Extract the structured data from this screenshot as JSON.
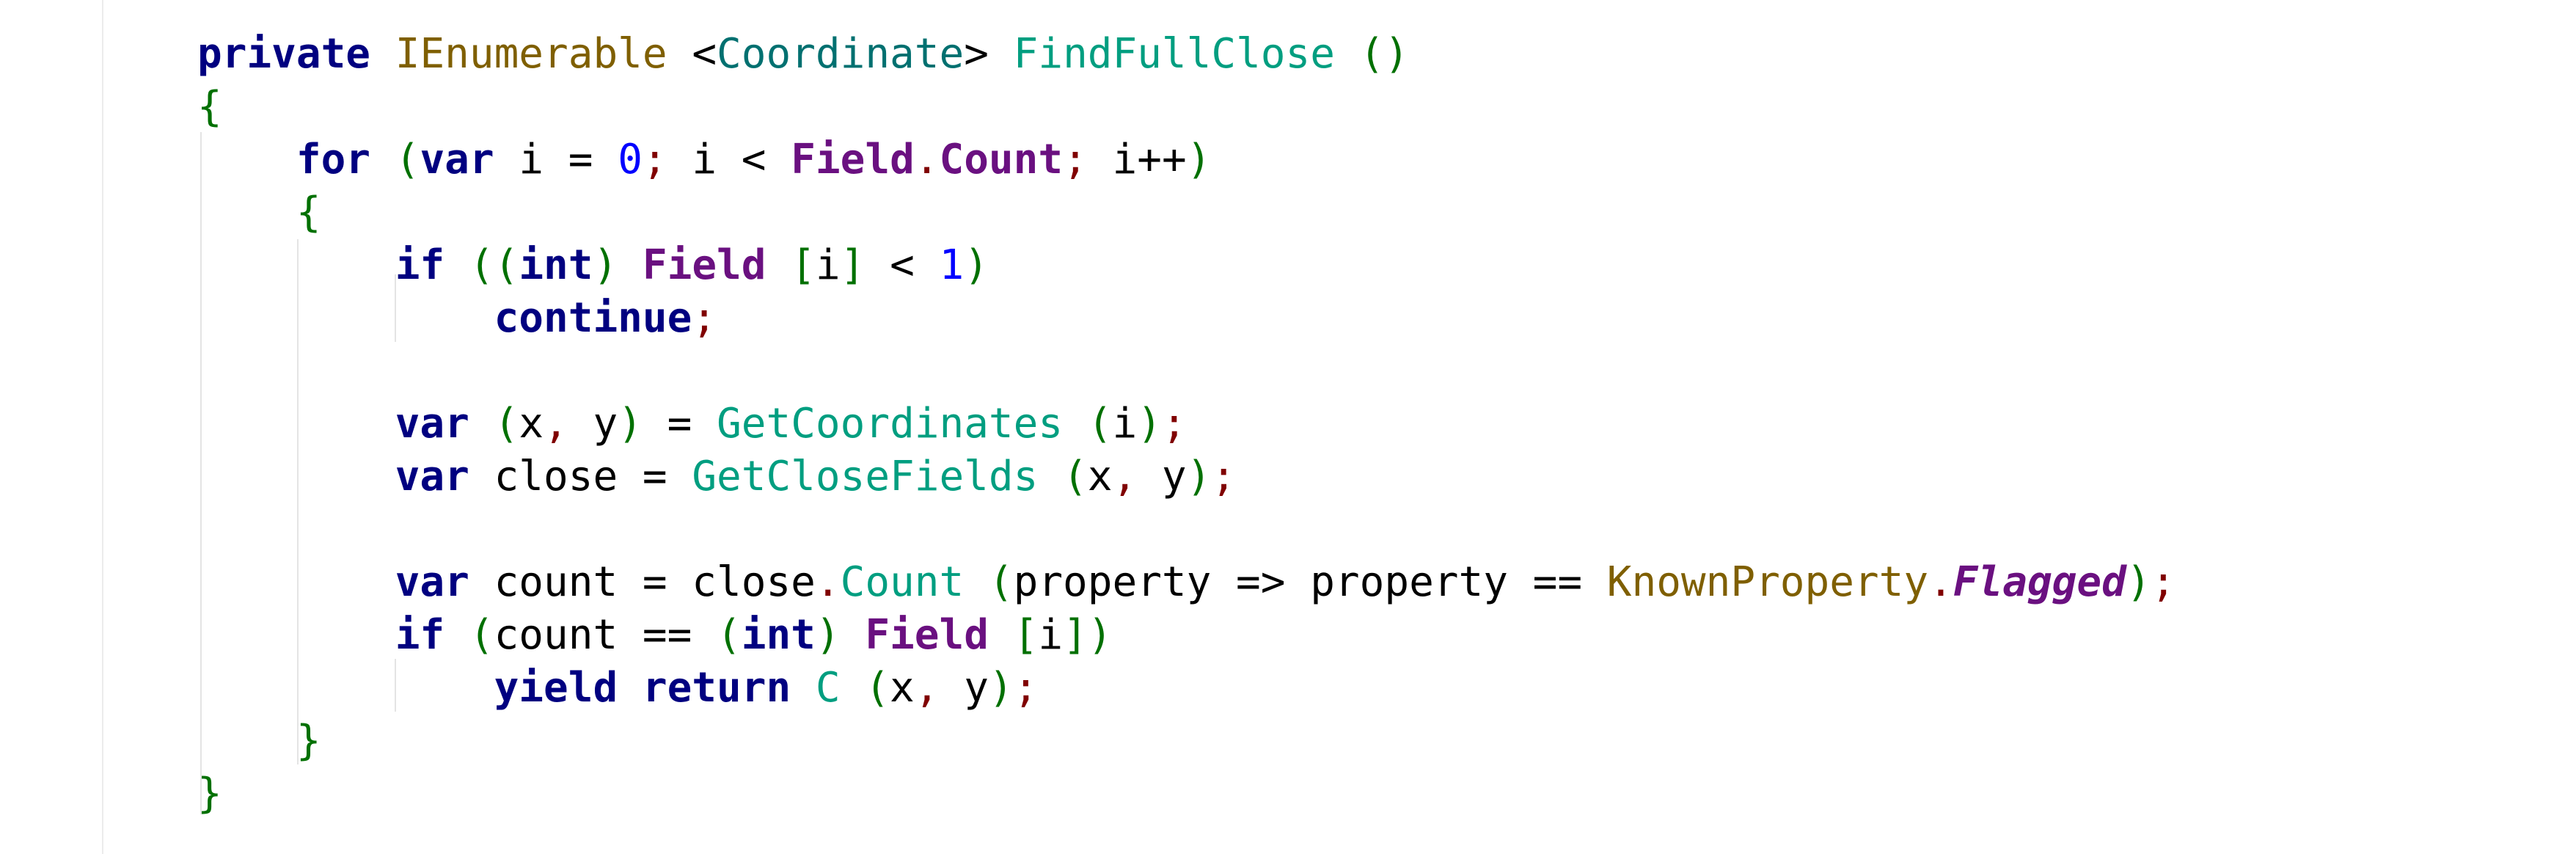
{
  "code": {
    "lines": [
      {
        "indent": 0,
        "tokens": [
          {
            "t": "private",
            "c": "kw"
          },
          {
            "t": " "
          },
          {
            "t": "IEnumerable",
            "c": "ty"
          },
          {
            "t": " <"
          },
          {
            "t": "Coordinate",
            "c": "ty2"
          },
          {
            "t": "> "
          },
          {
            "t": "FindFullClose",
            "c": "fn"
          },
          {
            "t": " "
          },
          {
            "t": "()",
            "c": "pa"
          }
        ]
      },
      {
        "indent": 0,
        "tokens": [
          {
            "t": "{",
            "c": "pa"
          }
        ]
      },
      {
        "indent": 1,
        "tokens": [
          {
            "t": "for",
            "c": "kw"
          },
          {
            "t": " "
          },
          {
            "t": "(",
            "c": "pa"
          },
          {
            "t": "var",
            "c": "kw"
          },
          {
            "t": " i = "
          },
          {
            "t": "0",
            "c": "nu"
          },
          {
            "t": ";",
            "c": "pu"
          },
          {
            "t": " i < "
          },
          {
            "t": "Field",
            "c": "pr"
          },
          {
            "t": ".",
            "c": "pu"
          },
          {
            "t": "Count",
            "c": "pr"
          },
          {
            "t": ";",
            "c": "pu"
          },
          {
            "t": " i++"
          },
          {
            "t": ")",
            "c": "pa"
          }
        ]
      },
      {
        "indent": 1,
        "tokens": [
          {
            "t": "{",
            "c": "pa"
          }
        ]
      },
      {
        "indent": 2,
        "tokens": [
          {
            "t": "if",
            "c": "kw"
          },
          {
            "t": " "
          },
          {
            "t": "((",
            "c": "pa"
          },
          {
            "t": "int",
            "c": "kw"
          },
          {
            "t": ")",
            "c": "pa"
          },
          {
            "t": " "
          },
          {
            "t": "Field",
            "c": "pr"
          },
          {
            "t": " "
          },
          {
            "t": "[",
            "c": "pa"
          },
          {
            "t": "i"
          },
          {
            "t": "]",
            "c": "pa"
          },
          {
            "t": " < "
          },
          {
            "t": "1",
            "c": "nu"
          },
          {
            "t": ")",
            "c": "pa"
          }
        ]
      },
      {
        "indent": 3,
        "tokens": [
          {
            "t": "continue",
            "c": "kw"
          },
          {
            "t": ";",
            "c": "pu"
          }
        ]
      },
      {
        "indent": 0,
        "tokens": []
      },
      {
        "indent": 2,
        "tokens": [
          {
            "t": "var",
            "c": "kw"
          },
          {
            "t": " "
          },
          {
            "t": "(",
            "c": "pa"
          },
          {
            "t": "x"
          },
          {
            "t": ",",
            "c": "pu"
          },
          {
            "t": " y"
          },
          {
            "t": ")",
            "c": "pa"
          },
          {
            "t": " = "
          },
          {
            "t": "GetCoordinates",
            "c": "fn"
          },
          {
            "t": " "
          },
          {
            "t": "(",
            "c": "pa"
          },
          {
            "t": "i"
          },
          {
            "t": ")",
            "c": "pa"
          },
          {
            "t": ";",
            "c": "pu"
          }
        ]
      },
      {
        "indent": 2,
        "tokens": [
          {
            "t": "var",
            "c": "kw"
          },
          {
            "t": " close = "
          },
          {
            "t": "GetCloseFields",
            "c": "fn"
          },
          {
            "t": " "
          },
          {
            "t": "(",
            "c": "pa"
          },
          {
            "t": "x"
          },
          {
            "t": ",",
            "c": "pu"
          },
          {
            "t": " y"
          },
          {
            "t": ")",
            "c": "pa"
          },
          {
            "t": ";",
            "c": "pu"
          }
        ]
      },
      {
        "indent": 0,
        "tokens": []
      },
      {
        "indent": 2,
        "tokens": [
          {
            "t": "var",
            "c": "kw"
          },
          {
            "t": " count = close"
          },
          {
            "t": ".",
            "c": "pu"
          },
          {
            "t": "Count",
            "c": "fn"
          },
          {
            "t": " "
          },
          {
            "t": "(",
            "c": "pa"
          },
          {
            "t": "property => property == "
          },
          {
            "t": "KnownProperty",
            "c": "ty"
          },
          {
            "t": ".",
            "c": "pu"
          },
          {
            "t": "Flagged",
            "c": "pri"
          },
          {
            "t": ")",
            "c": "pa"
          },
          {
            "t": ";",
            "c": "pu"
          }
        ]
      },
      {
        "indent": 2,
        "tokens": [
          {
            "t": "if",
            "c": "kw"
          },
          {
            "t": " "
          },
          {
            "t": "(",
            "c": "pa"
          },
          {
            "t": "count == "
          },
          {
            "t": "(",
            "c": "pa"
          },
          {
            "t": "int",
            "c": "kw"
          },
          {
            "t": ")",
            "c": "pa"
          },
          {
            "t": " "
          },
          {
            "t": "Field",
            "c": "pr"
          },
          {
            "t": " "
          },
          {
            "t": "[",
            "c": "pa"
          },
          {
            "t": "i"
          },
          {
            "t": "])",
            "c": "pa"
          }
        ]
      },
      {
        "indent": 3,
        "tokens": [
          {
            "t": "yield",
            "c": "kw"
          },
          {
            "t": " "
          },
          {
            "t": "return",
            "c": "kw"
          },
          {
            "t": " "
          },
          {
            "t": "C",
            "c": "fn"
          },
          {
            "t": " "
          },
          {
            "t": "(",
            "c": "pa"
          },
          {
            "t": "x"
          },
          {
            "t": ",",
            "c": "pu"
          },
          {
            "t": " y"
          },
          {
            "t": ")",
            "c": "pa"
          },
          {
            "t": ";",
            "c": "pu"
          }
        ]
      },
      {
        "indent": 1,
        "tokens": [
          {
            "t": "}",
            "c": "pa"
          }
        ]
      },
      {
        "indent": 0,
        "tokens": [
          {
            "t": "}",
            "c": "pa"
          }
        ]
      }
    ]
  }
}
